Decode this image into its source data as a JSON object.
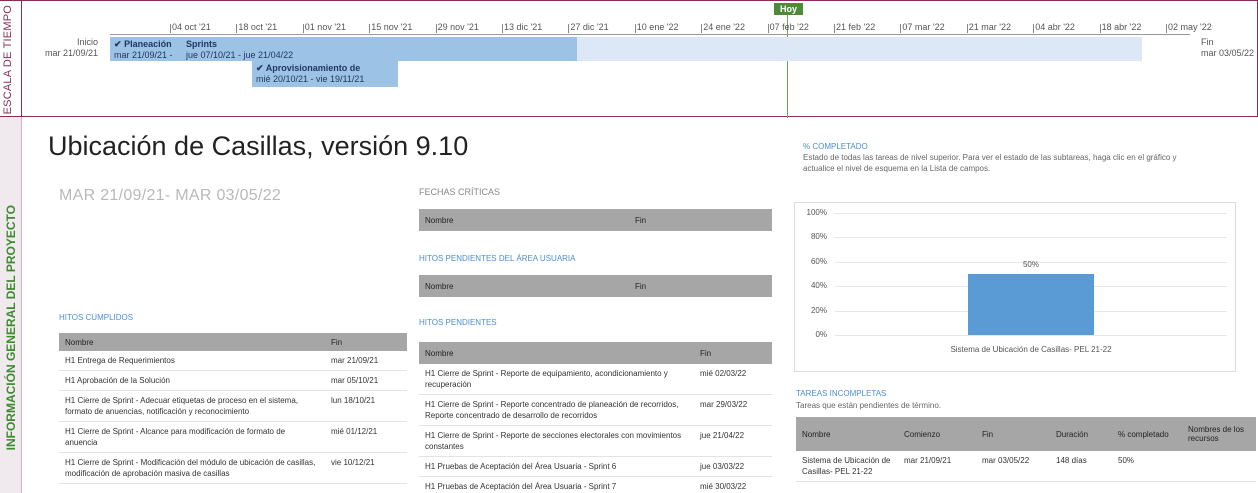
{
  "timeline": {
    "side_label": "ESCALA DE TIEMPO",
    "today_label": "Hoy",
    "start_label": "Inicio",
    "start_date": "mar 21/09/21",
    "end_label": "Fin",
    "end_date": "mar 03/05/22",
    "ticks": [
      "04 oct '21",
      "18 oct '21",
      "01 nov '21",
      "15 nov '21",
      "29 nov '21",
      "13 dic '21",
      "27 dic '21",
      "10 ene '22",
      "24 ene '22",
      "07 feb '22",
      "21 feb '22",
      "07 mar '22",
      "21 mar '22",
      "04 abr '22",
      "18 abr '22",
      "02 may '22"
    ],
    "tasks": [
      {
        "name": "Planeación",
        "dates": "mar 21/09/21 -",
        "check": "✔"
      },
      {
        "name": "Sprints",
        "dates": "jue 07/10/21 - jue 21/04/22",
        "check": ""
      },
      {
        "name": "Aprovisionamiento de",
        "dates": "mié 20/10/21 - vie 19/11/21",
        "check": "✔"
      }
    ]
  },
  "overview": {
    "side_label": "INFORMACIÓN GENERAL DEL PROYECTO",
    "title": "Ubicación de Casillas, versión 9.10",
    "dates": "MAR 21/09/21- MAR 03/05/22"
  },
  "fechas_criticas": {
    "title": "FECHAS CRÍTICAS",
    "headers": [
      "Nombre",
      "Fin"
    ]
  },
  "hitos_area_usuaria": {
    "title": "HITOS PENDIENTES DEL ÁREA USUARIA",
    "headers": [
      "Nombre",
      "Fin"
    ]
  },
  "hitos_cumplidos": {
    "title": "HITOS CUMPLIDOS",
    "headers": [
      "Nombre",
      "Fin"
    ],
    "rows": [
      [
        "H1 Entrega de Requerimientos",
        "mar 21/09/21"
      ],
      [
        "H1 Aprobación de la Solución",
        "mar 05/10/21"
      ],
      [
        "H1 Cierre de Sprint - Adecuar etiquetas de proceso en el sistema, formato de anuencias, notificación y reconocimiento",
        "lun 18/10/21"
      ],
      [
        "H1 Cierre de Sprint - Alcance para modificación de formato de anuencia",
        "mié 01/12/21"
      ],
      [
        "H1 Cierre de Sprint - Modificación del módulo de ubicación de casillas, modificación de aprobación masiva de casillas",
        "vie 10/12/21"
      ]
    ]
  },
  "hitos_pendientes": {
    "title": "HITOS PENDIENTES",
    "headers": [
      "Nombre",
      "Fin"
    ],
    "rows": [
      [
        "H1 Cierre de Sprint - Reporte de equipamiento, acondicionamiento y recuperación",
        "mié 02/03/22"
      ],
      [
        "H1 Cierre de Sprint - Reporte concentrado de planeación de recorridos, Reporte concentrado de desarrollo de recorridos",
        "mar 29/03/22"
      ],
      [
        "H1 Cierre de Sprint - Reporte de secciones electorales con movimientos constantes",
        "jue 21/04/22"
      ],
      [
        "H1 Pruebas de Aceptación del Área Usuaria - Sprint 6",
        "jue 03/03/22"
      ],
      [
        "H1 Pruebas de Aceptación del Área Usuaria - Sprint 7",
        "mié 30/03/22"
      ]
    ]
  },
  "completado": {
    "title": "% COMPLETADO",
    "desc": "Estado de todas las tareas de nivel superior. Para ver el estado de las subtareas, haga clic en el gráfico y actualice el nivel de esquema en la Lista de campos."
  },
  "chart_data": {
    "type": "bar",
    "categories": [
      "Sistema de Ubicación de Casillas- PEL 21-22"
    ],
    "values": [
      50
    ],
    "value_labels": [
      "50%"
    ],
    "y_ticks": [
      "0%",
      "20%",
      "40%",
      "60%",
      "80%",
      "100%"
    ],
    "ylim": [
      0,
      100
    ],
    "bar_color": "#5b9bd5"
  },
  "tareas_incompletas": {
    "title": "TAREAS INCOMPLETAS",
    "desc": "Tareas que están pendientes de término.",
    "headers": [
      "Nombre",
      "Comienzo",
      "Fin",
      "Duración",
      "% completado",
      "Nombres de los recursos"
    ],
    "rows": [
      [
        "Sistema de Ubicación de Casillas- PEL 21-22",
        "mar 21/09/21",
        "mar 03/05/22",
        "148 días",
        "50%",
        ""
      ]
    ]
  }
}
